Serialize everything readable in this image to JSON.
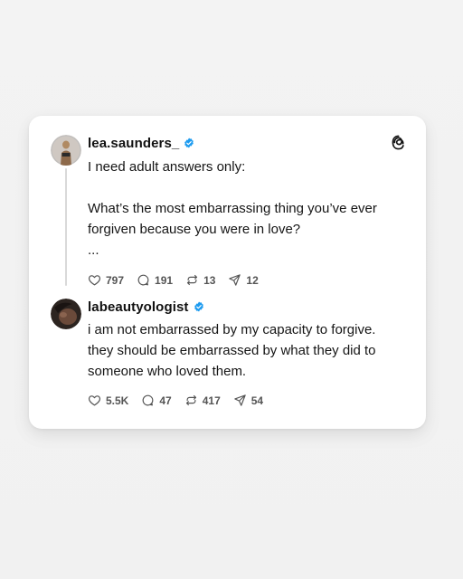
{
  "posts": [
    {
      "handle": "lea.saunders_",
      "verified": true,
      "text": "I need adult answers only:\n\nWhat’s the most embarrassing thing you’ve ever\nforgiven because you were in love?\n...",
      "likes": "797",
      "replies": "191",
      "reposts": "13",
      "shares": "12"
    },
    {
      "handle": "labeautyologist",
      "verified": true,
      "text": "i am not embarrassed by my capacity to forgive.\nthey should be embarrassed by what they did to\nsomeone who loved them.",
      "likes": "5.5K",
      "replies": "47",
      "reposts": "417",
      "shares": "54"
    }
  ],
  "icons": {
    "like": "heart-icon",
    "reply": "comment-icon",
    "repost": "repost-icon",
    "share": "share-icon",
    "verified": "verified-badge-icon",
    "logo": "threads-logo-icon"
  },
  "colors": {
    "verified": "#1d9bf0",
    "text": "#151515",
    "muted": "#555555",
    "background": "#f2f2f2",
    "card": "#ffffff"
  }
}
